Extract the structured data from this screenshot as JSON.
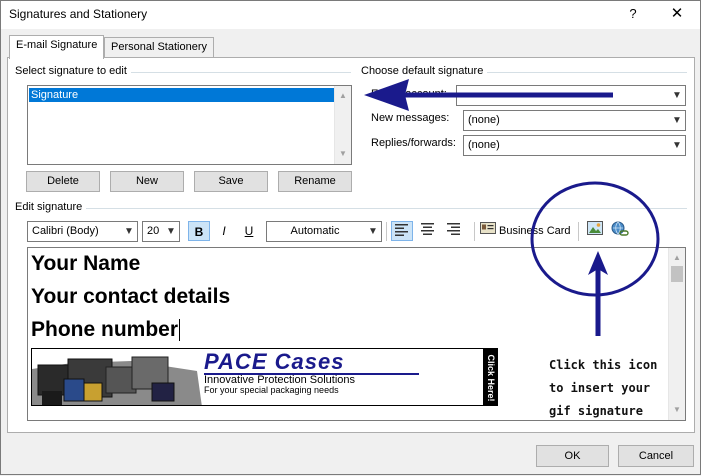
{
  "window": {
    "title": "Signatures and Stationery",
    "help_label": "?",
    "close_label": "✕"
  },
  "tabs": [
    {
      "label": "E-mail Signature",
      "active": true
    },
    {
      "label": "Personal Stationery",
      "active": false
    }
  ],
  "select_group": {
    "label": "Select signature to edit",
    "items": [
      {
        "label": "Signature",
        "selected": true
      }
    ],
    "buttons": {
      "delete": "Delete",
      "new": "New",
      "save": "Save",
      "rename": "Rename"
    }
  },
  "default_group": {
    "label": "Choose default signature",
    "account_label": "E-mail account:",
    "new_messages_label": "New messages:",
    "new_messages_value": "(none)",
    "replies_label": "Replies/forwards:",
    "replies_value": "(none)"
  },
  "edit_group": {
    "label": "Edit signature",
    "font_name": "Calibri (Body)",
    "font_size": "20",
    "bold": "B",
    "italic": "I",
    "underline": "U",
    "color": "Automatic",
    "business_card": "Business Card"
  },
  "signature": {
    "line1": "Your Name",
    "line2": "Your contact details",
    "line3": "Phone number",
    "banner": {
      "brand": "PACE Cases",
      "tagline1": "Innovative Protection Solutions",
      "tagline2": "For your special packaging needs",
      "side_text": "Click Here!"
    }
  },
  "annotation": {
    "line1": "Click this icon",
    "line2": "to insert your",
    "line3": "gif signature",
    "color": "#1a1a8c"
  },
  "footer": {
    "ok": "OK",
    "cancel": "Cancel"
  },
  "colors": {
    "accent": "#0078d7",
    "annotation": "#1a1a8c",
    "banner_brand": "#1a1a8c"
  }
}
